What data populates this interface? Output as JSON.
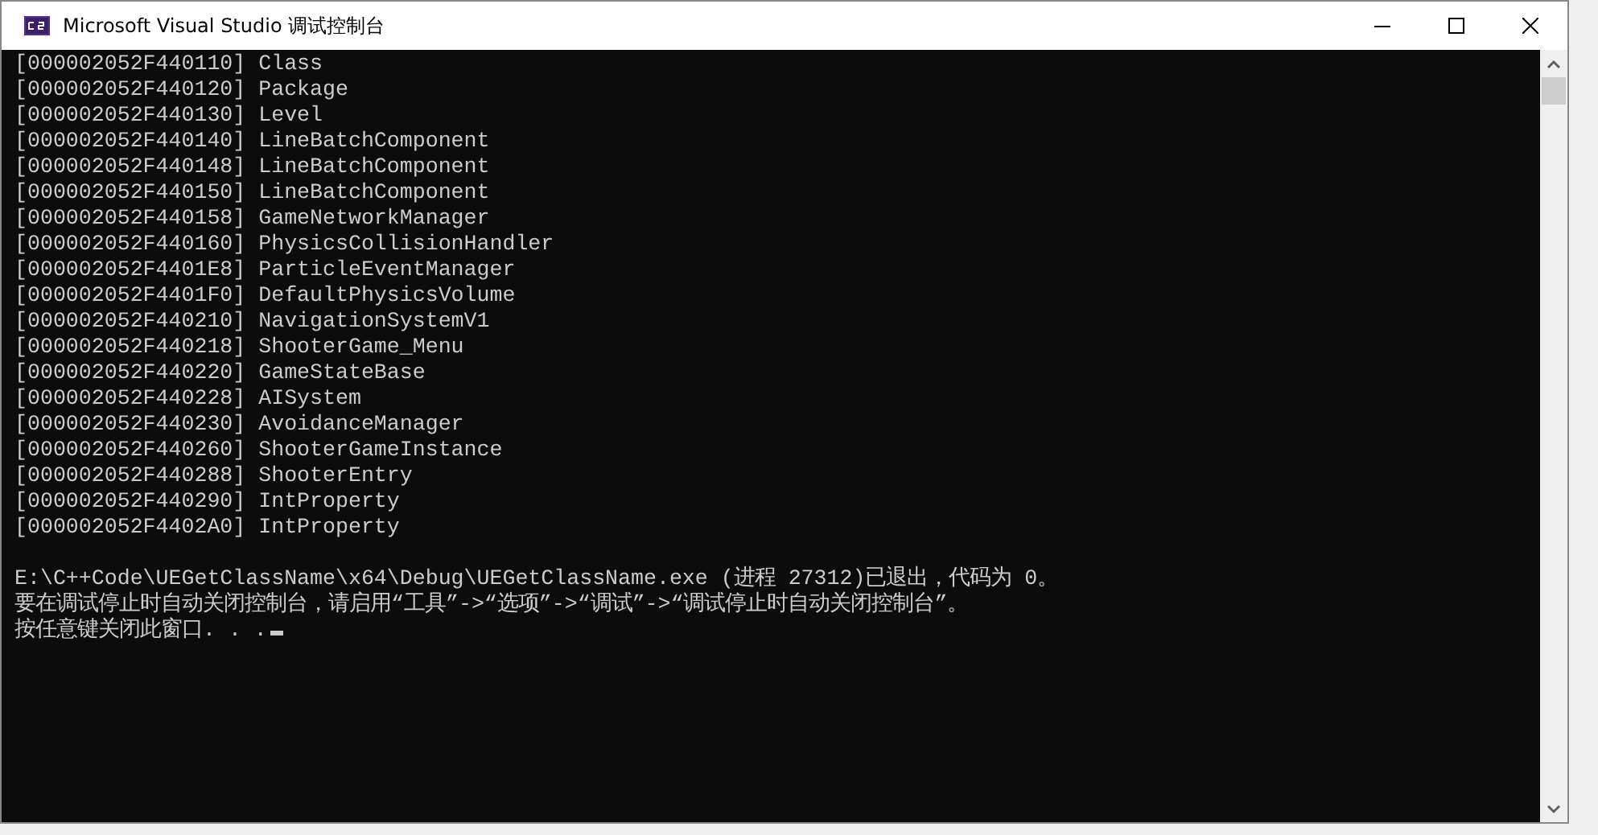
{
  "window": {
    "title": "Microsoft Visual Studio 调试控制台"
  },
  "console": {
    "lines": [
      "[000002052F440110] Class",
      "[000002052F440120] Package",
      "[000002052F440130] Level",
      "[000002052F440140] LineBatchComponent",
      "[000002052F440148] LineBatchComponent",
      "[000002052F440150] LineBatchComponent",
      "[000002052F440158] GameNetworkManager",
      "[000002052F440160] PhysicsCollisionHandler",
      "[000002052F4401E8] ParticleEventManager",
      "[000002052F4401F0] DefaultPhysicsVolume",
      "[000002052F440210] NavigationSystemV1",
      "[000002052F440218] ShooterGame_Menu",
      "[000002052F440220] GameStateBase",
      "[000002052F440228] AISystem",
      "[000002052F440230] AvoidanceManager",
      "[000002052F440260] ShooterGameInstance",
      "[000002052F440288] ShooterEntry",
      "[000002052F440290] IntProperty",
      "[000002052F4402A0] IntProperty"
    ],
    "messages": [
      "E:\\C++Code\\UEGetClassName\\x64\\Debug\\UEGetClassName.exe (进程 27312)已退出，代码为 0。",
      "要在调试停止时自动关闭控制台，请启用“工具”->“选项”->“调试”->“调试停止时自动关闭控制台”。",
      "按任意键关闭此窗口. . ."
    ]
  }
}
